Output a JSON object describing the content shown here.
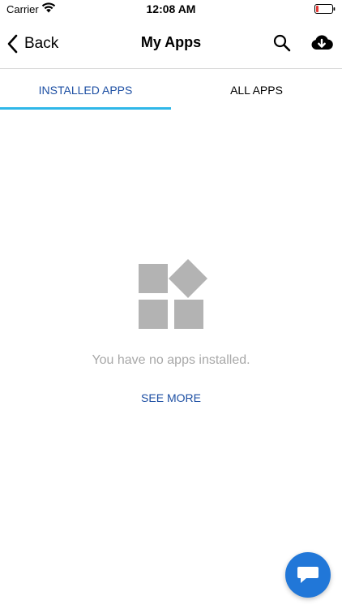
{
  "status_bar": {
    "carrier": "Carrier",
    "time": "12:08 AM"
  },
  "nav": {
    "back_label": "Back",
    "title": "My Apps"
  },
  "tabs": [
    {
      "label": "INSTALLED APPS",
      "active": true
    },
    {
      "label": "ALL APPS",
      "active": false
    }
  ],
  "empty_state": {
    "message": "You have no apps installed.",
    "action_label": "SEE MORE"
  },
  "icons": {
    "search": "search-icon",
    "download": "cloud-download-icon",
    "chat": "chat-bubble-icon",
    "empty": "apps-grid-icon"
  },
  "colors": {
    "accent_text": "#1d4fa3",
    "tab_indicator": "#2fb7e8",
    "muted_text": "#a8a8a8",
    "placeholder_grey": "#b3b3b3",
    "fab": "#2177d8"
  }
}
